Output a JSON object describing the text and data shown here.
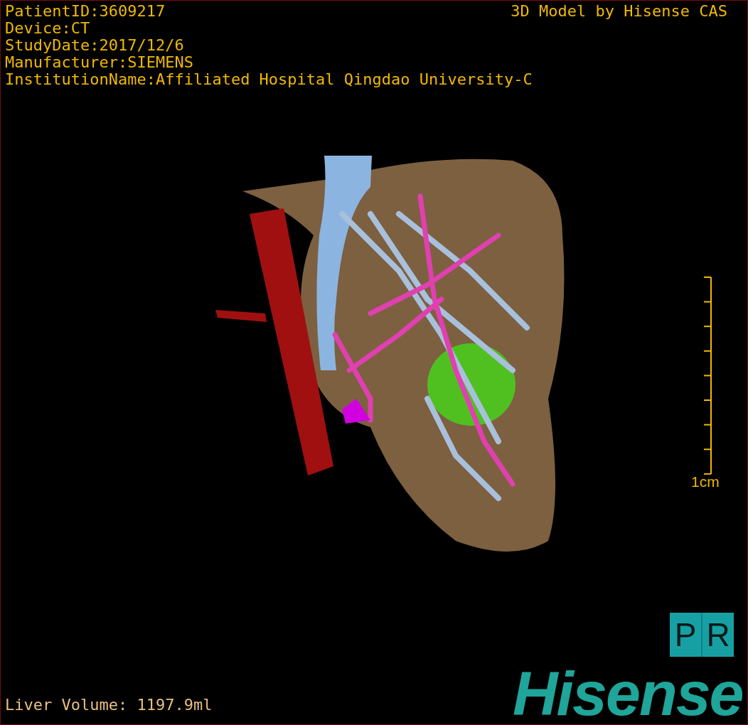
{
  "info_lines": [
    "PatientID:3609217",
    "Device:CT",
    "StudyDate:2017/12/6",
    "Manufacturer:SIEMENS",
    "InstitutionName:Affiliated Hospital Qingdao University-C"
  ],
  "title": "3D Model by Hisense CAS",
  "scale_bar": {
    "label": "1cm"
  },
  "view_badge": [
    "P",
    "R"
  ],
  "logo": "Hisense",
  "liver_volume": "Liver Volume: 1197.9ml"
}
